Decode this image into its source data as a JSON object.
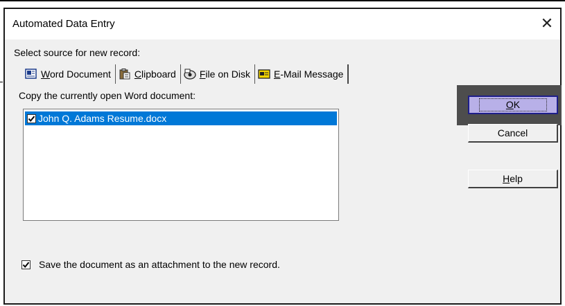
{
  "dialog": {
    "title": "Automated Data Entry",
    "close_glyph": "✕"
  },
  "source": {
    "label": "Select source for new record:",
    "tabs": [
      {
        "icon": "word-document-icon",
        "accel": "W",
        "rest": "ord Document",
        "active": true
      },
      {
        "icon": "clipboard-icon",
        "accel": "C",
        "rest": "lipboard",
        "active": false
      },
      {
        "icon": "file-on-disk-icon",
        "accel": "F",
        "rest": "ile on Disk",
        "active": false
      },
      {
        "icon": "email-message-icon",
        "accel": "E",
        "rest": "-Mail Message",
        "active": false
      }
    ]
  },
  "word_panel": {
    "label": "Copy the currently open Word document:",
    "documents": [
      {
        "name": "John Q. Adams Resume.docx",
        "checked": true,
        "selected": true
      }
    ],
    "save_attachment": {
      "label": "Save the document as an attachment to the new record.",
      "checked": true
    }
  },
  "buttons": {
    "ok": {
      "accel": "O",
      "rest": "K"
    },
    "cancel": {
      "label": "Cancel"
    },
    "help": {
      "accel": "H",
      "rest": "elp"
    }
  },
  "colors": {
    "selection": "#0078d7",
    "ok_highlight": "#b8b0e8",
    "ok_frame": "#4d4d4d"
  }
}
